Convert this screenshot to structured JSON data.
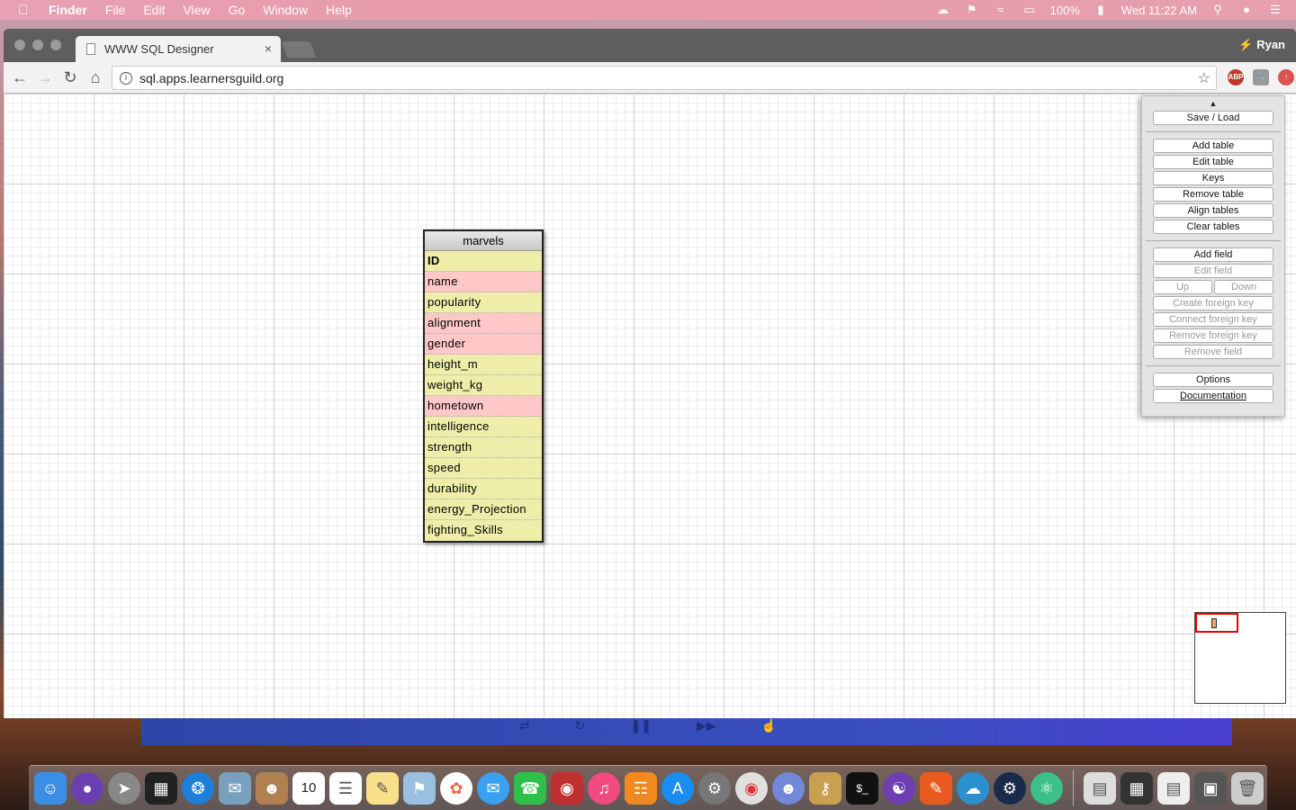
{
  "menubar": {
    "app": "Finder",
    "items": [
      "File",
      "Edit",
      "View",
      "Go",
      "Window",
      "Help"
    ],
    "battery": "100%",
    "clock": "Wed 11:22 AM"
  },
  "browser": {
    "tab_title": "WWW SQL Designer",
    "tab_close": "×",
    "profile": "Ryan",
    "url": "sql.apps.learnersguild.org",
    "ext_abp": "ABP"
  },
  "table": {
    "name": "marvels",
    "fields": [
      {
        "name": "ID",
        "color": "yellow",
        "pk": true
      },
      {
        "name": "name",
        "color": "pink"
      },
      {
        "name": "popularity",
        "color": "yellow"
      },
      {
        "name": "alignment",
        "color": "pink"
      },
      {
        "name": "gender",
        "color": "pink"
      },
      {
        "name": "height_m",
        "color": "yellow"
      },
      {
        "name": "weight_kg",
        "color": "yellow"
      },
      {
        "name": "hometown",
        "color": "pink"
      },
      {
        "name": "intelligence",
        "color": "yellow"
      },
      {
        "name": "strength",
        "color": "yellow"
      },
      {
        "name": "speed",
        "color": "yellow"
      },
      {
        "name": "durability",
        "color": "yellow"
      },
      {
        "name": "energy_Projection",
        "color": "yellow"
      },
      {
        "name": "fighting_Skills",
        "color": "yellow"
      }
    ]
  },
  "panel": {
    "save_load": "Save / Load",
    "add_table": "Add table",
    "edit_table": "Edit table",
    "keys": "Keys",
    "remove_table": "Remove table",
    "align_tables": "Align tables",
    "clear_tables": "Clear tables",
    "add_field": "Add field",
    "edit_field": "Edit field",
    "up": "Up",
    "down": "Down",
    "create_fk": "Create foreign key",
    "connect_fk": "Connect foreign key",
    "remove_fk": "Remove foreign key",
    "remove_field": "Remove field",
    "options": "Options",
    "documentation": "Documentation"
  },
  "dock": {
    "calendar_day": "10"
  }
}
